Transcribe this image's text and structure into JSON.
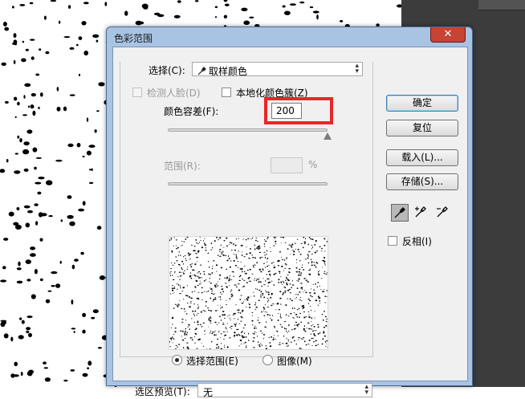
{
  "dialog": {
    "title": "色彩范围",
    "close_label": "✕",
    "select": {
      "label": "选择(C):",
      "value": "取样颜色"
    },
    "detect_faces": {
      "label": "检测人脸(D)",
      "checked": false,
      "enabled": false
    },
    "localized_clusters": {
      "label": "本地化颜色簇(Z)",
      "checked": false
    },
    "fuzziness": {
      "label": "颜色容差(F):",
      "value": "200",
      "level": 1.0
    },
    "range": {
      "label": "范围(R):",
      "value": "",
      "unit": "%",
      "enabled": false
    },
    "view": {
      "selection_label": "选择范围(E)",
      "image_label": "图像(M)",
      "selected": "selection"
    },
    "preview": {
      "label": "选区预览(T):",
      "value": "无"
    },
    "buttons": {
      "ok": "确定",
      "reset": "复位",
      "load": "载入(L)...",
      "save": "存储(S)..."
    },
    "eyedroppers": [
      {
        "icon": "eyedropper-icon",
        "active": true
      },
      {
        "icon": "eyedropper-plus-icon",
        "active": false
      },
      {
        "icon": "eyedropper-minus-icon",
        "active": false
      }
    ],
    "invert": {
      "label": "反相(I)",
      "checked": false
    }
  },
  "colors": {
    "highlight": "#e8262a",
    "close": "#c64436",
    "frame": "#a9c3e3"
  }
}
